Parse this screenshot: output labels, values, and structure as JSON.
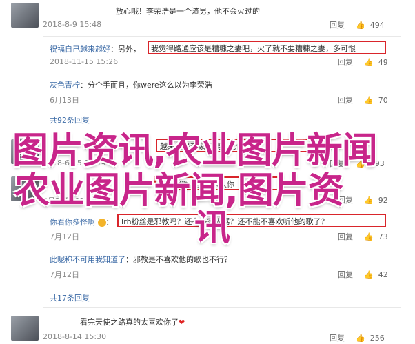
{
  "comments": [
    {
      "user": "",
      "text": "放心哦！李荣浩是一个渣男，他不会火过的",
      "date": "2018-8-9 15:48",
      "reply_label": "回复",
      "likes": "494",
      "type": "main"
    },
    {
      "user": "祝福自己越来越好",
      "text": "另外，",
      "highlight": "我觉得路通应该是糟糠之妻吧，火了就不要糟糠之妻，多可恨",
      "date": "2018-11-15 15:26",
      "reply_label": "回复",
      "likes": "49",
      "type": "reply"
    },
    {
      "user": "灰色青柠",
      "text": "分个手而且，你were这么以为李荣浩",
      "date": "6月13日",
      "reply_label": "回复",
      "likes": "70",
      "type": "reply"
    },
    {
      "user": "",
      "text": "共92条回复",
      "type": "more"
    },
    {
      "user": "",
      "text": "就这",
      "highlight": "越来越是李家阿姨，凭什么他",
      "date": "2018-6-15 12:14",
      "reply_label": "回复",
      "likes": "193",
      "type": "main"
    },
    {
      "user": "",
      "text": "黄小茶好好玩",
      "highlight": "他的嗯嗯，我爱家人你",
      "date": "5月20日 01:12",
      "reply_label": "回复",
      "likes": "92",
      "type": "main"
    },
    {
      "user": "你看你多怪啊",
      "text": "",
      "highlight": "Irh粉丝是邪教吗？还有多家人骂？还不能不喜欢听他的歌了？",
      "date": "7月12日",
      "reply_label": "回复",
      "likes": "73",
      "type": "reply"
    },
    {
      "user": "此昵称不可用我知道了",
      "text": "邪教是不喜欢他的歌也不行？",
      "date": "7月12日",
      "reply_label": "回复",
      "likes": "42",
      "type": "reply"
    },
    {
      "user": "",
      "text": "共17条回复",
      "type": "more"
    },
    {
      "user": "",
      "text": "看完天使之路真的太喜欢你了",
      "date": "2018-8-14 15:30",
      "reply_label": "回复",
      "likes": "256",
      "type": "main"
    }
  ],
  "overlay": {
    "line1": "图片资讯,农业图片新闻",
    "line2": "农业图片新闻,图片资",
    "line3": "讯"
  },
  "colors": {
    "highlight_border": "#d9252b",
    "overlay_text": "#c8258a",
    "link": "#3b6aa6"
  },
  "icons": {
    "comment": "speech-bubble-icon",
    "like": "thumbs-up-icon"
  }
}
